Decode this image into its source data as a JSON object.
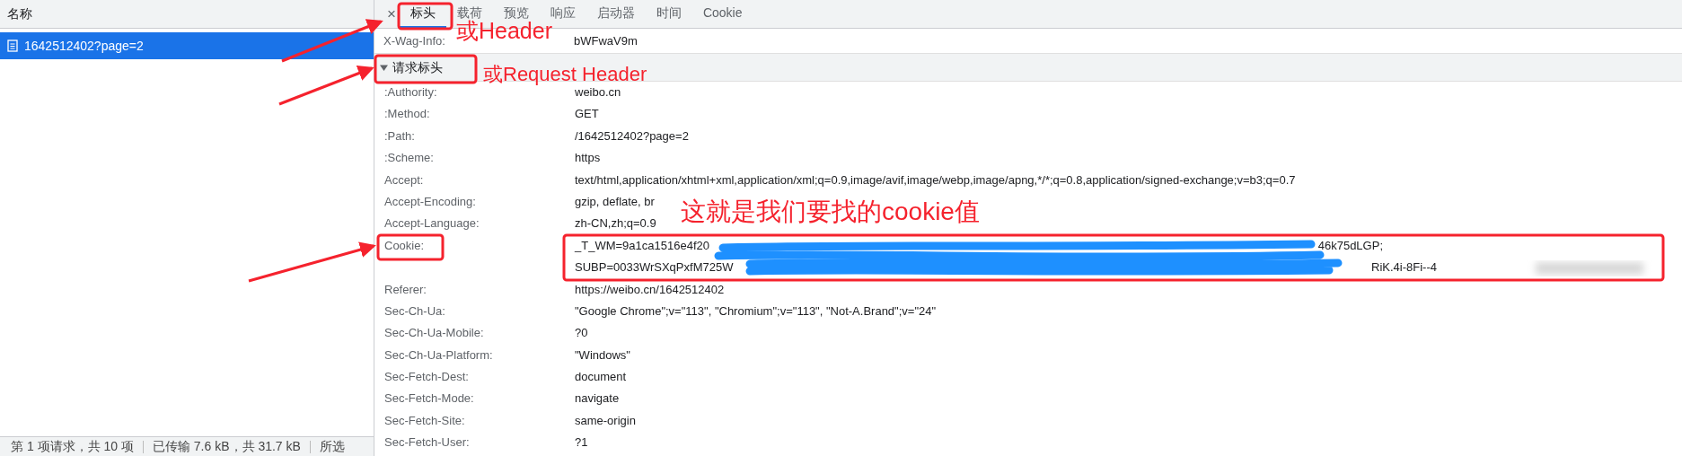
{
  "left_panel": {
    "column_header": "名称",
    "requests": [
      {
        "name": "1642512402?page=2",
        "selected": true
      }
    ]
  },
  "status_bar": [
    "第 1 项请求，共 10 项",
    "已传输 7.6 kB，共 31.7 kB",
    "所选"
  ],
  "close_tab": "×",
  "tabs": [
    {
      "label": "标头",
      "selected": true
    },
    {
      "label": "载荷",
      "selected": false
    },
    {
      "label": "预览",
      "selected": false
    },
    {
      "label": "响应",
      "selected": false
    },
    {
      "label": "启动器",
      "selected": false
    },
    {
      "label": "时间",
      "selected": false
    },
    {
      "label": "Cookie",
      "selected": false
    }
  ],
  "partial_header": {
    "name": "X-Wag-Info:",
    "value": "bWFwaV9m"
  },
  "section": {
    "title": "请求标头",
    "expanded": true
  },
  "headers": [
    {
      "kind": "plain",
      "name": ":Authority:",
      "value": "weibo.cn"
    },
    {
      "kind": "plain",
      "name": ":Method:",
      "value": "GET"
    },
    {
      "kind": "plain",
      "name": ":Path:",
      "value": "/1642512402?page=2"
    },
    {
      "kind": "plain",
      "name": ":Scheme:",
      "value": "https"
    },
    {
      "kind": "plain",
      "name": "Accept:",
      "value": "text/html,application/xhtml+xml,application/xml;q=0.9,image/avif,image/webp,image/apng,*/*;q=0.8,application/signed-exchange;v=b3;q=0.7"
    },
    {
      "kind": "plain",
      "name": "Accept-Encoding:",
      "value": "gzip, deflate, br"
    },
    {
      "kind": "plain",
      "name": "Accept-Language:",
      "value": "zh-CN,zh;q=0.9"
    },
    {
      "kind": "redacted",
      "name": "Cookie:",
      "lines": [
        [
          "_T_WM=9a1ca1516e4f20",
          "46k75dLGP;"
        ],
        [
          "SUBP=0033WrSXqPxfM725W",
          "RiK.4i-8Fi--4"
        ]
      ]
    },
    {
      "kind": "plain",
      "name": "Referer:",
      "value": "https://weibo.cn/1642512402"
    },
    {
      "kind": "plain",
      "name": "Sec-Ch-Ua:",
      "value": "\"Google Chrome\";v=\"113\", \"Chromium\";v=\"113\", \"Not-A.Brand\";v=\"24\""
    },
    {
      "kind": "plain",
      "name": "Sec-Ch-Ua-Mobile:",
      "value": "?0"
    },
    {
      "kind": "plain",
      "name": "Sec-Ch-Ua-Platform:",
      "value": "\"Windows\""
    },
    {
      "kind": "plain",
      "name": "Sec-Fetch-Dest:",
      "value": "document"
    },
    {
      "kind": "plain",
      "name": "Sec-Fetch-Mode:",
      "value": "navigate"
    },
    {
      "kind": "plain",
      "name": "Sec-Fetch-Site:",
      "value": "same-origin"
    },
    {
      "kind": "plain",
      "name": "Sec-Fetch-User:",
      "value": "?1"
    }
  ],
  "annotations": [
    "或Header",
    "或Request Header",
    "这就是我们要找的cookie值"
  ]
}
